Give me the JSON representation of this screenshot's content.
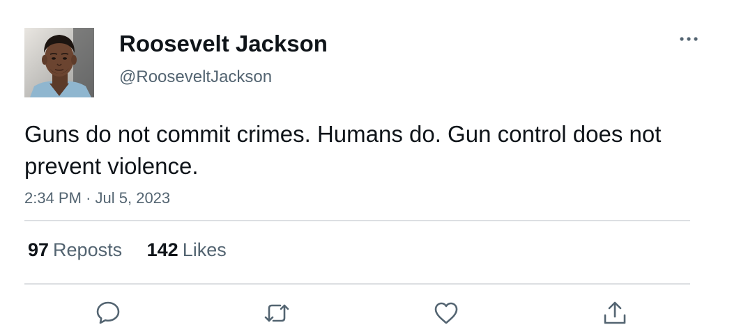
{
  "tweet": {
    "author": {
      "display_name": "Roosevelt Jackson",
      "handle": "@RooseveltJackson",
      "avatar_icon": "avatar-photo"
    },
    "text": "Guns do not commit crimes. Humans do. Gun control does not prevent violence.",
    "timestamp": {
      "time": "2:34 PM",
      "separator": "·",
      "date": "Jul 5, 2023"
    },
    "stats": {
      "reposts_count": "97",
      "reposts_label": "Reposts",
      "likes_count": "142",
      "likes_label": "Likes"
    },
    "actions": {
      "reply_icon": "reply-icon",
      "repost_icon": "repost-icon",
      "like_icon": "like-icon",
      "share_icon": "share-icon"
    },
    "more_icon": "more-icon"
  },
  "colors": {
    "text_primary": "#0f1419",
    "text_secondary": "#536471",
    "divider": "#dcdfe2",
    "icon": "#536471"
  }
}
